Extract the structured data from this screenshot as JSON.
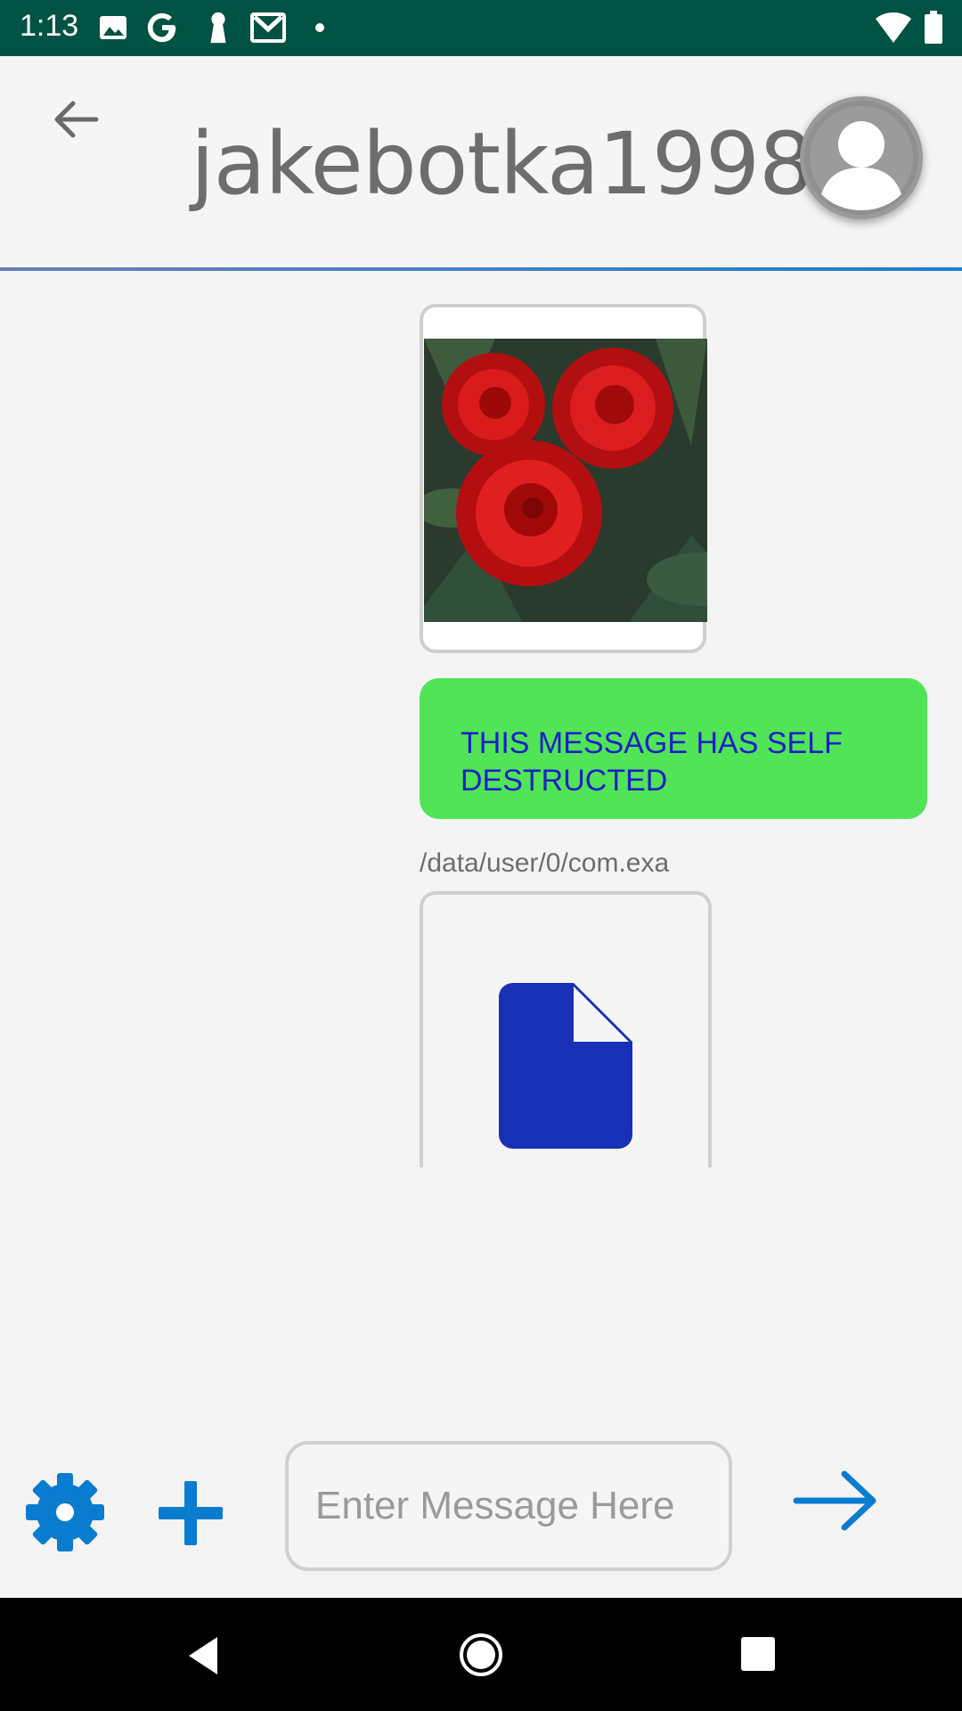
{
  "status_bar": {
    "time": "1:13",
    "background": "#005244",
    "left_icons": [
      "image-icon",
      "google-g-icon",
      "keyhole-icon",
      "gmail-icon",
      "dot-icon"
    ],
    "right_icons": [
      "wifi-icon",
      "battery-icon"
    ]
  },
  "header": {
    "title": "jakebotka1998",
    "back_icon": "arrow-back-icon",
    "avatar_icon": "user-avatar-icon"
  },
  "messages": [
    {
      "type": "image",
      "description_icon": "image-attachment"
    },
    {
      "type": "text",
      "text": "THIS MESSAGE HAS SELF DESTRUCTED",
      "bubble_color": "#50e456",
      "text_color": "#1c1fc9"
    },
    {
      "type": "file",
      "path": "/data/user/0/com.exa",
      "icon": "file-icon",
      "icon_color": "#1730b6"
    }
  ],
  "input_bar": {
    "placeholder": "Enter Message Here",
    "value": "",
    "settings_icon": "gear-icon",
    "add_icon": "plus-icon",
    "send_icon": "arrow-forward-icon",
    "accent": "#0a7cd0"
  },
  "nav_bar": {
    "icons": [
      "nav-back-icon",
      "nav-home-icon",
      "nav-recents-icon"
    ]
  }
}
